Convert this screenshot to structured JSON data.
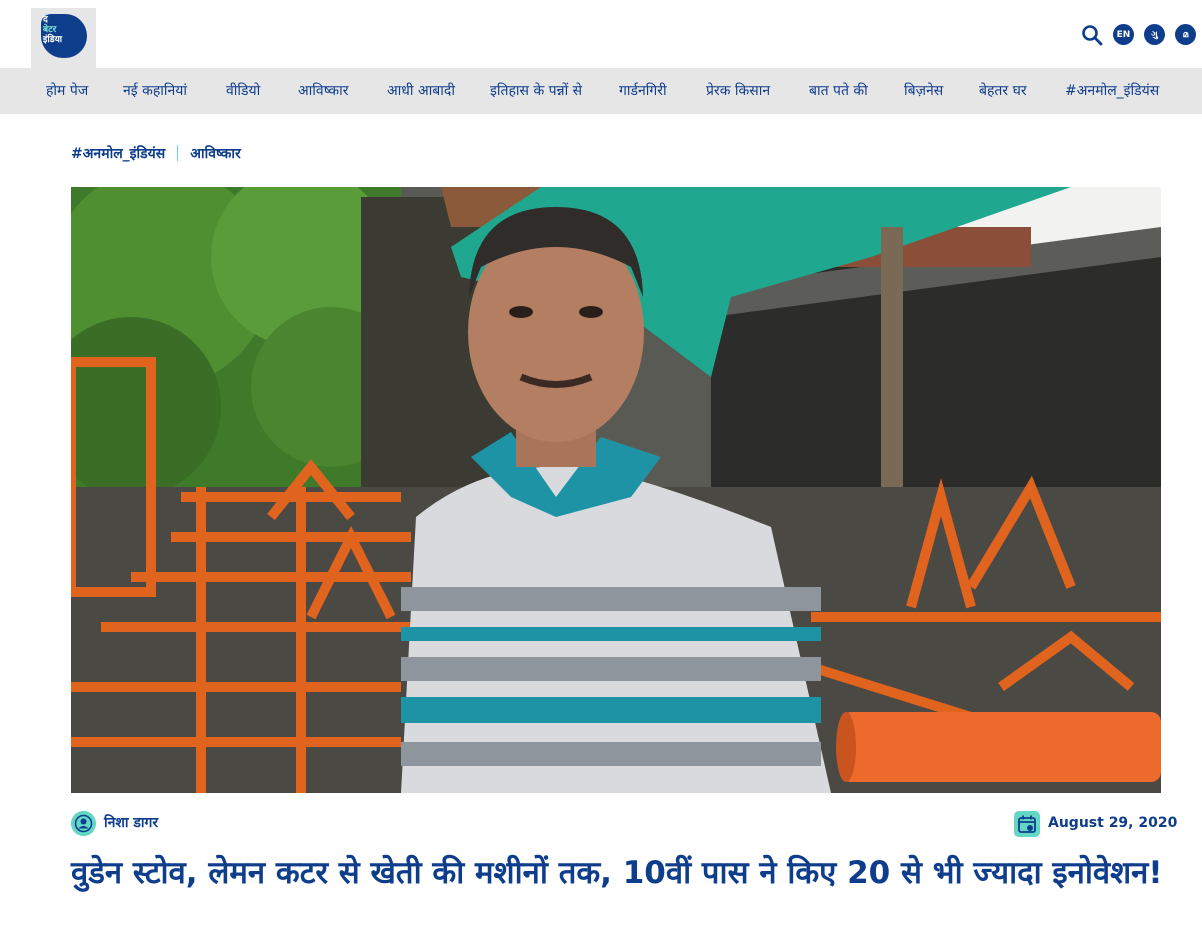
{
  "header": {
    "logo_line1": "द",
    "logo_line2": "बेटर",
    "logo_line3": "इंडिया",
    "languages": [
      "EN",
      "ગુ",
      "മ"
    ]
  },
  "nav": {
    "items": [
      "होम पेज",
      "नई कहानियां",
      "वीडियो",
      "आविष्कार",
      "आधी आबादी",
      "इतिहास के पन्नों से",
      "गार्डनगिरी",
      "प्रेरक किसान",
      "बात पते की",
      "बिज़नेस",
      "बेहतर घर",
      "#अनमोल_इंडियंस"
    ]
  },
  "breadcrumb": {
    "tag1": "#अनमोल_इंडियंस",
    "tag2": "आविष्कार"
  },
  "article": {
    "author": "निशा डागर",
    "date": "August 29, 2020",
    "title": "वुडेन स्टोव, लेमन कटर से खेती की मशीनों तक, 10वीं पास ने किए 20 से भी ज्यादा इनोवेशन!"
  },
  "colors": {
    "brand_blue": "#0e3d8c",
    "accent_teal": "#64d6c4",
    "nav_bg": "#e6e6e6"
  },
  "icons": {
    "search": "search-icon",
    "author": "user-icon",
    "date": "calendar-icon"
  }
}
